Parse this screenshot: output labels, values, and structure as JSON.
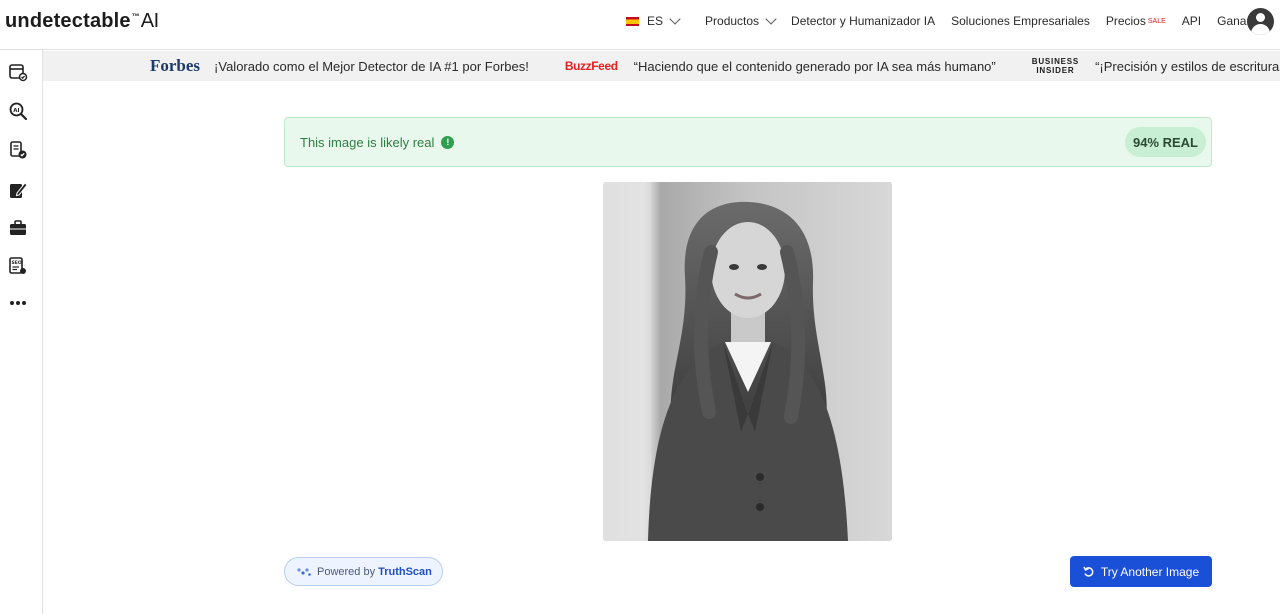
{
  "brand": {
    "name": "undetectable",
    "tm": "™",
    "suffix": "AI"
  },
  "nav": {
    "language": "ES",
    "items": [
      "Productos",
      "Detector y Humanizador IA",
      "Soluciones Empresariales",
      "Precios",
      "API",
      "Ganar"
    ],
    "sale_badge": "SALE"
  },
  "sidebar": {
    "icons": [
      "browser-check-icon",
      "ai-search-icon",
      "document-check-icon",
      "edit-note-icon",
      "briefcase-icon",
      "seo-report-icon",
      "more-icon"
    ]
  },
  "press": {
    "forbes_logo": "Forbes",
    "forbes_quote": "¡Valorado como el Mejor Detector de IA #1 por Forbes!",
    "buzzfeed_logo": "BuzzFeed",
    "buzzfeed_quote": "“Haciendo que el contenido generado por IA sea más humano”",
    "bi_logo_line1": "BUSINESS",
    "bi_logo_line2": "INSIDER",
    "bi_quote": "“¡Precisión y estilos de escritura incomparables!”"
  },
  "result": {
    "message": "This image is likely real",
    "info_glyph": "!",
    "badge": "94% REAL",
    "real_percent": 94,
    "accent_color": "#2f9e4f"
  },
  "footer": {
    "powered_prefix": "Powered by",
    "powered_brand": "TruthScan",
    "try_button": "Try Another Image"
  },
  "colors": {
    "primary": "#1a4fd8",
    "success_bg": "#e8f8ec",
    "sale": "#e01b1b"
  }
}
